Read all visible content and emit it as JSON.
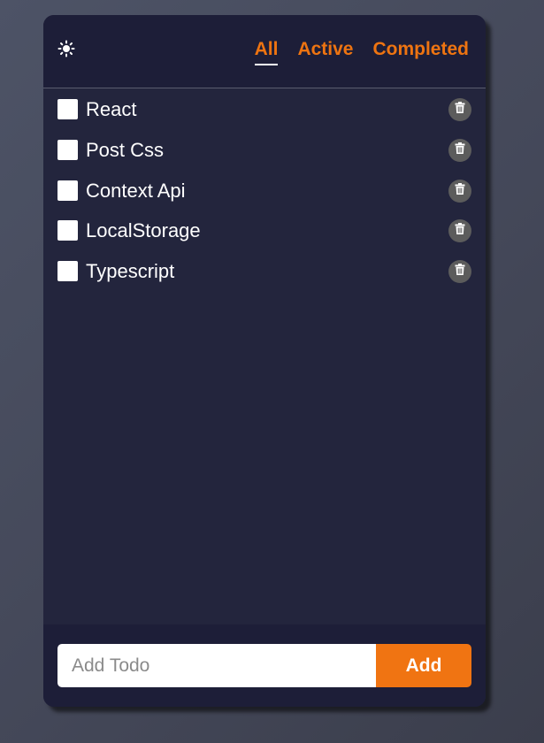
{
  "header": {
    "theme_icon": "sun-icon",
    "tabs": [
      {
        "label": "All",
        "active": true
      },
      {
        "label": "Active",
        "active": false
      },
      {
        "label": "Completed",
        "active": false
      }
    ]
  },
  "todos": [
    {
      "label": "React",
      "checked": false
    },
    {
      "label": "Post Css",
      "checked": false
    },
    {
      "label": "Context Api",
      "checked": false
    },
    {
      "label": "LocalStorage",
      "checked": false
    },
    {
      "label": "Typescript",
      "checked": false
    }
  ],
  "footer": {
    "input_value": "",
    "input_placeholder": "Add Todo",
    "add_label": "Add"
  },
  "colors": {
    "accent": "#ee7411",
    "card_bg": "#23253d",
    "header_bg": "#1d1e38"
  }
}
